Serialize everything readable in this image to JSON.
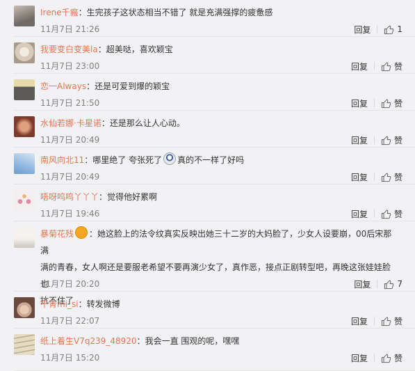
{
  "comments": [
    {
      "user": "Irene千瘢",
      "text": "生完孩子这状态相当不错了 就是充满强撑的疲惫感",
      "date": "11月7日 21:26",
      "reply": "回复",
      "like": "1",
      "av": [
        "#6f6a66",
        "#c9bdb2"
      ]
    },
    {
      "user": "我要变白变美la",
      "text": "超美哒，喜欢颖宝",
      "date": "11月7日 23:00",
      "reply": "回复",
      "like": "赞",
      "av": [
        "#d9cbbb",
        "#a89a8b"
      ]
    },
    {
      "user": "恋一Always",
      "text": "还是可爱到爆的颖宝",
      "date": "11月7日 21:50",
      "reply": "回复",
      "like": "赞",
      "av": [
        "#e8d9a8",
        "#5b5a57"
      ]
    },
    {
      "user": "水仙若娜·卡星诺",
      "text": "还是那么让人心动。",
      "date": "11月7日 20:49",
      "reply": "回复",
      "like": "赞",
      "av": [
        "#7d3a2c",
        "#e0a07d"
      ]
    },
    {
      "user": "南风向北11",
      "text": "哪里绝了 夸张死了",
      "text2": "真的不一样了好吗",
      "date": "11月7日 20:49",
      "reply": "回复",
      "like": "赞",
      "av": [
        "#8fb7e0",
        "#d9e6f2"
      ]
    },
    {
      "user": "唔呀呜呜丫丫丫",
      "text": "觉得他好累啊",
      "date": "11月7日 19:46",
      "reply": "回复",
      "like": "赞",
      "av": [
        "#f3eef0",
        "#e58aa0"
      ]
    },
    {
      "user": "暴菊花残",
      "text": "她这脸上的法令纹真实反映出她三十二岁的大妈脸了，少女人设要崩，00后宋那满",
      "text2": "满的青春，女人啊还是要服老希望不要再演少女了，真作恶，接点正剧转型吧，再晚这张娃娃脸也",
      "text3": "抗不住了",
      "date": "11月7日 20:20",
      "reply": "回复",
      "like": "7",
      "av": [
        "#f4f1ee",
        "#c9c5c0"
      ]
    },
    {
      "user": "千青mi_si",
      "text": "转发微博",
      "date": "11月7日 22:07",
      "reply": "回复",
      "like": "赞",
      "av": [
        "#caa893",
        "#6a4a3c"
      ]
    },
    {
      "user": "纸上着生V7q239_48920",
      "text": "我会一直 围观的呢，嘿嘿",
      "date": "11月7日 15:20",
      "reply": "回复",
      "like": "赞",
      "av": [
        "#e6dcc5",
        "#b9ab8d"
      ]
    }
  ],
  "colors": {
    "username": "#eb7350",
    "meta": "#808080",
    "background": "#f2f2f5"
  },
  "icons": {
    "like": "thumbs-up-icon"
  }
}
